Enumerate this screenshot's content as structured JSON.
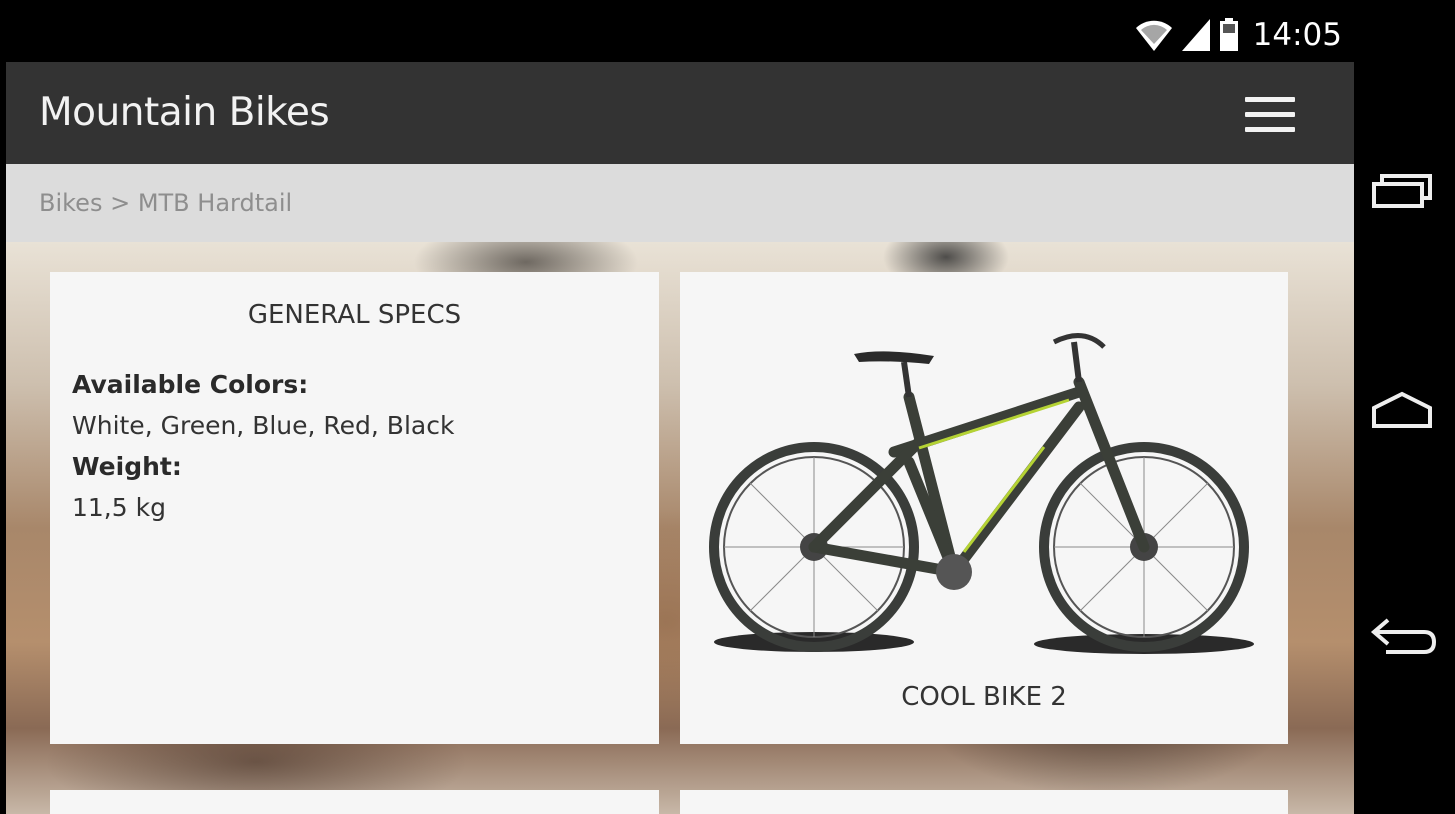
{
  "status_bar": {
    "time": "14:05",
    "icons": [
      "wifi-icon",
      "signal-icon",
      "battery-icon"
    ]
  },
  "app_bar": {
    "title": "Mountain Bikes",
    "menu_icon": "hamburger-menu-icon"
  },
  "breadcrumb": {
    "text": "Bikes > MTB Hardtail"
  },
  "specs_card": {
    "title": "GENERAL SPECS",
    "items": [
      {
        "label": "Available Colors:",
        "value": "White, Green, Blue, Red, Black"
      },
      {
        "label": "Weight:",
        "value": "11,5 kg"
      }
    ]
  },
  "bike_card": {
    "name": "COOL BIKE 2"
  },
  "nav_bar": {
    "buttons": [
      "recent-apps-icon",
      "home-icon",
      "back-icon"
    ]
  },
  "colors": {
    "app_bar": "#333333",
    "breadcrumb_bg": "#dcdcdc",
    "card_bg": "#f6f6f6",
    "bike_accent": "#b5d334"
  }
}
